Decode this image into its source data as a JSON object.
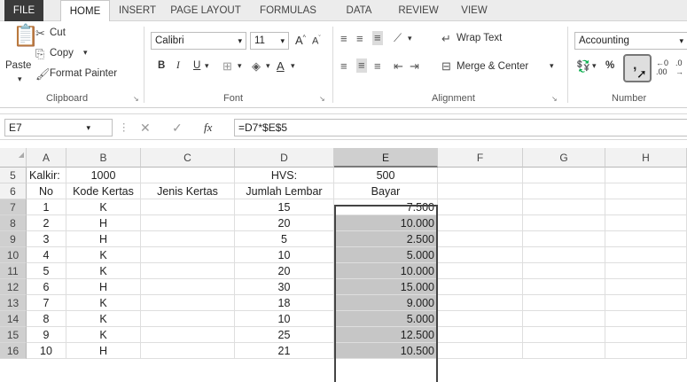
{
  "ribbon_tabs": [
    {
      "label": "FILE"
    },
    {
      "label": "HOME"
    },
    {
      "label": "INSERT"
    },
    {
      "label": "PAGE LAYOUT"
    },
    {
      "label": "FORMULAS"
    },
    {
      "label": "DATA"
    },
    {
      "label": "REVIEW"
    },
    {
      "label": "VIEW"
    }
  ],
  "clipboard": {
    "paste": "Paste",
    "cut": "Cut",
    "copy": "Copy",
    "format_painter": "Format Painter",
    "group": "Clipboard"
  },
  "font": {
    "name": "Calibri",
    "size": "11",
    "bold": "B",
    "italic": "I",
    "underline": "U",
    "group": "Font"
  },
  "alignment": {
    "wrap_text": "Wrap Text",
    "merge_center": "Merge & Center",
    "group": "Alignment"
  },
  "number": {
    "format": "Accounting",
    "percent": "%",
    "group": "Number"
  },
  "formula_bar": {
    "name_box": "E7",
    "cancel": "✕",
    "enter": "✓",
    "fx": "fx",
    "formula": "=D7*$E$5"
  },
  "columns": [
    "A",
    "B",
    "C",
    "D",
    "E",
    "F",
    "G",
    "H"
  ],
  "rows": [
    {
      "num": "5",
      "cells": [
        "Kalkir:",
        "1000",
        "",
        "HVS:",
        "500"
      ]
    },
    {
      "num": "6",
      "cells": [
        "No",
        "Kode Kertas",
        "Jenis Kertas",
        "Jumlah Lembar",
        "Bayar"
      ]
    },
    {
      "num": "7",
      "cells": [
        "1",
        "K",
        "",
        "15",
        "7.500"
      ]
    },
    {
      "num": "8",
      "cells": [
        "2",
        "H",
        "",
        "20",
        "10.000"
      ]
    },
    {
      "num": "9",
      "cells": [
        "3",
        "H",
        "",
        "5",
        "2.500"
      ]
    },
    {
      "num": "10",
      "cells": [
        "4",
        "K",
        "",
        "10",
        "5.000"
      ]
    },
    {
      "num": "11",
      "cells": [
        "5",
        "K",
        "",
        "20",
        "10.000"
      ]
    },
    {
      "num": "12",
      "cells": [
        "6",
        "H",
        "",
        "30",
        "15.000"
      ]
    },
    {
      "num": "13",
      "cells": [
        "7",
        "K",
        "",
        "18",
        "9.000"
      ]
    },
    {
      "num": "14",
      "cells": [
        "8",
        "K",
        "",
        "10",
        "5.000"
      ]
    },
    {
      "num": "15",
      "cells": [
        "9",
        "K",
        "",
        "25",
        "12.500"
      ]
    },
    {
      "num": "16",
      "cells": [
        "10",
        "H",
        "",
        "21",
        "10.500"
      ]
    }
  ]
}
